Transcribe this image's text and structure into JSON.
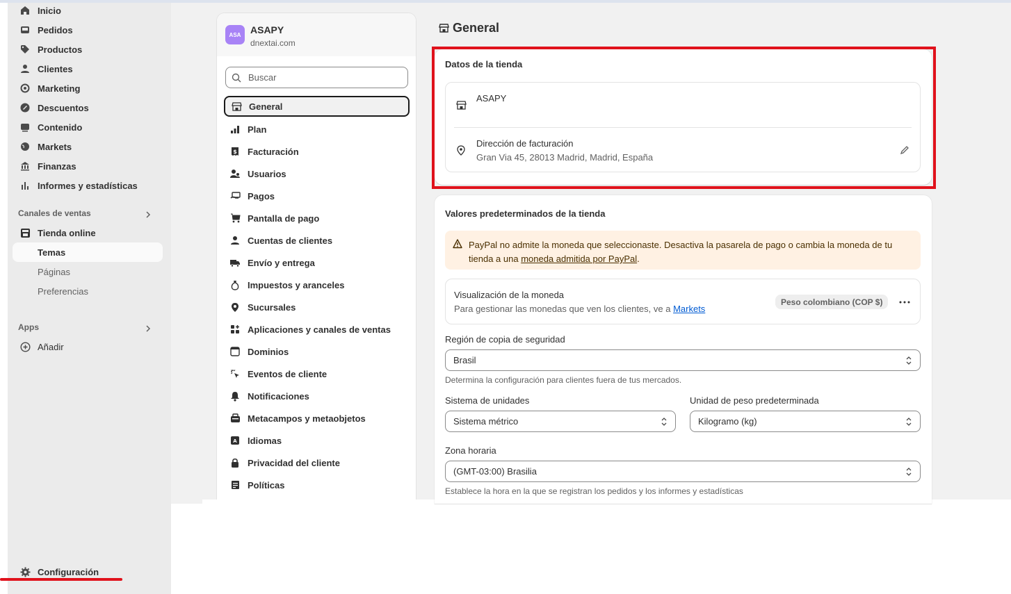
{
  "nav": {
    "items": [
      {
        "label": "Inicio",
        "icon": "home-icon"
      },
      {
        "label": "Pedidos",
        "icon": "inbox-icon"
      },
      {
        "label": "Productos",
        "icon": "tag-icon"
      },
      {
        "label": "Clientes",
        "icon": "person-icon"
      },
      {
        "label": "Marketing",
        "icon": "target-icon"
      },
      {
        "label": "Descuentos",
        "icon": "discount-icon"
      },
      {
        "label": "Contenido",
        "icon": "content-icon"
      },
      {
        "label": "Markets",
        "icon": "globe-icon"
      },
      {
        "label": "Finanzas",
        "icon": "bank-icon"
      },
      {
        "label": "Informes y estadísticas",
        "icon": "chart-icon"
      }
    ],
    "sales_channels_label": "Canales de ventas",
    "online_store_label": "Tienda online",
    "online_store_subitems": [
      "Temas",
      "Páginas",
      "Preferencias"
    ],
    "apps_label": "Apps",
    "add_label": "Añadir",
    "settings_label": "Configuración"
  },
  "store": {
    "initials": "ASA",
    "name": "ASAPY",
    "domain": "dnextai.com"
  },
  "settings": {
    "search_placeholder": "Buscar",
    "items": [
      "General",
      "Plan",
      "Facturación",
      "Usuarios",
      "Pagos",
      "Pantalla de pago",
      "Cuentas de clientes",
      "Envío y entrega",
      "Impuestos y aranceles",
      "Sucursales",
      "Aplicaciones y canales de ventas",
      "Dominios",
      "Eventos de cliente",
      "Notificaciones",
      "Metacampos y metaobjetos",
      "Idiomas",
      "Privacidad del cliente",
      "Políticas"
    ]
  },
  "page": {
    "title": "General",
    "store_details": {
      "title": "Datos de la tienda",
      "store_name": "ASAPY",
      "billing_label": "Dirección de facturación",
      "billing_address": "Gran Via 45, 28013 Madrid, Madrid, España"
    },
    "defaults": {
      "title": "Valores predeterminados de la tienda",
      "warning_text": "PayPal no admite la moneda que seleccionaste. Desactiva la pasarela de pago o cambia la moneda de tu tienda a una ",
      "warning_link": "moneda admitida por PayPal",
      "warning_end": ".",
      "currency_title": "Visualización de la moneda",
      "currency_sub": "Para gestionar las monedas que ven los clientes, ve a ",
      "currency_link": "Markets",
      "currency_badge": "Peso colombiano (COP $)",
      "backup_label": "Región de copia de seguridad",
      "backup_value": "Brasil",
      "backup_help": "Determina la configuración para clientes fuera de tus mercados.",
      "units_label": "Sistema de unidades",
      "units_value": "Sistema métrico",
      "weight_label": "Unidad de peso predeterminada",
      "weight_value": "Kilogramo (kg)",
      "timezone_label": "Zona horaria",
      "timezone_value": "(GMT-03:00) Brasilia",
      "timezone_help": "Establece la hora en la que se registran los pedidos y los informes y estadísticas"
    }
  },
  "colors": {
    "highlight": "#e0121c",
    "link": "#005bd3",
    "warning_bg": "#fff1e3",
    "avatar": "#a883f6"
  }
}
